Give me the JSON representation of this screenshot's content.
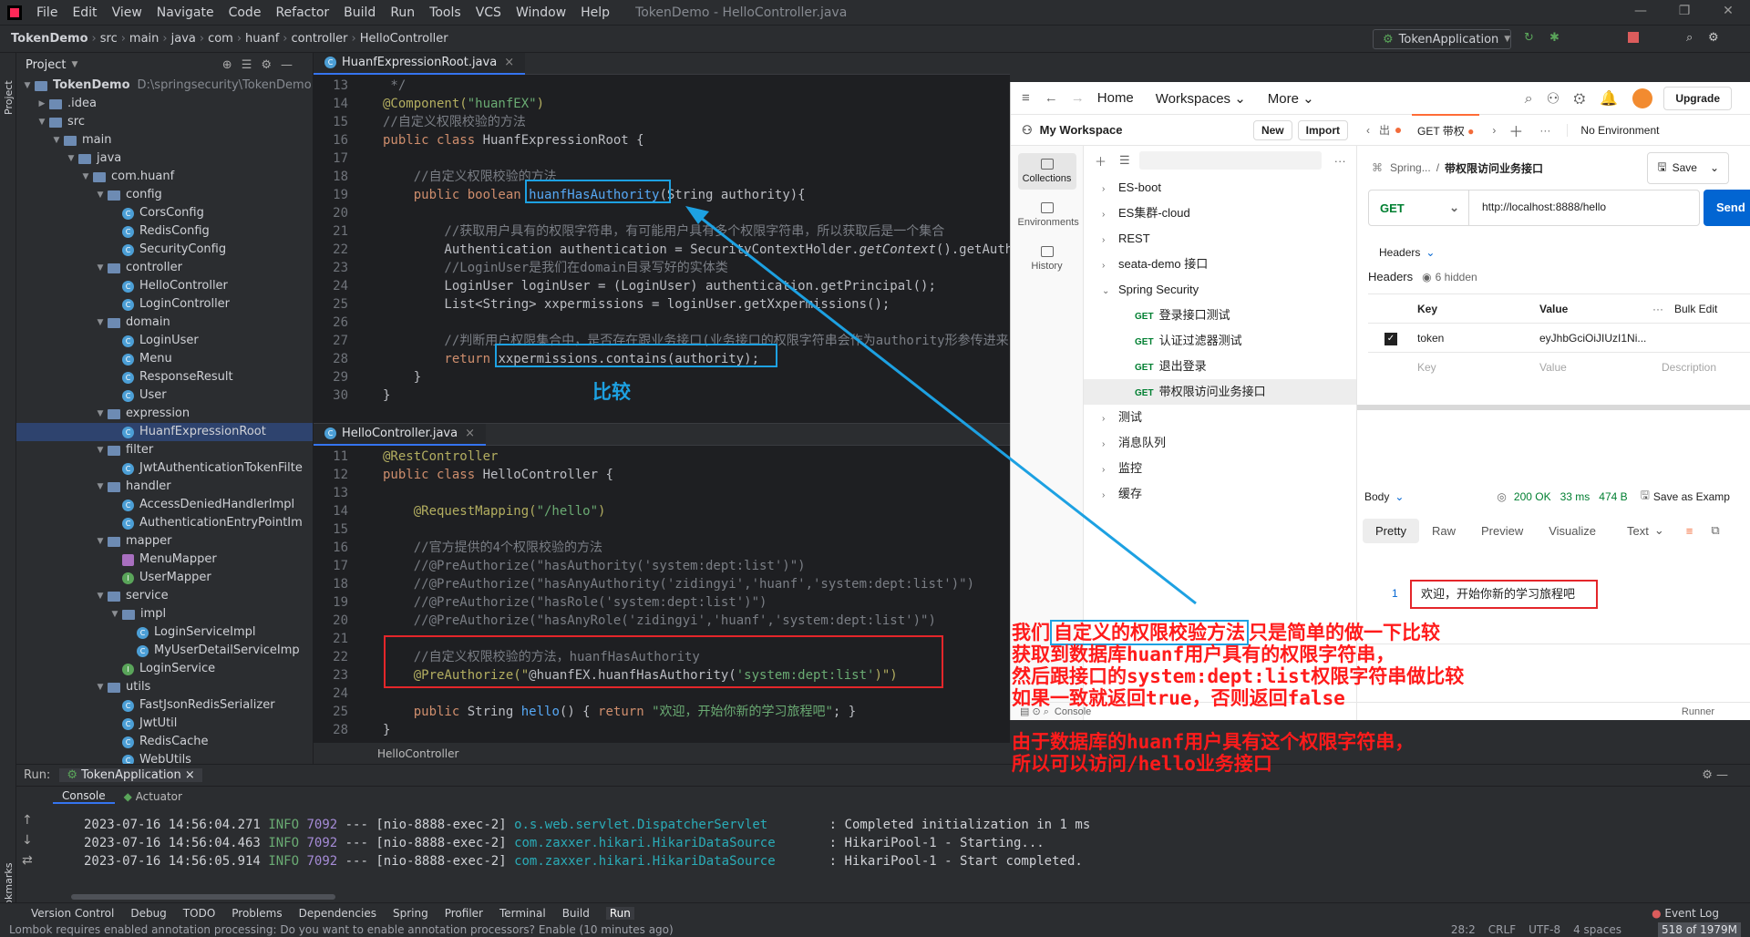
{
  "menubar": {
    "items": [
      "File",
      "Edit",
      "View",
      "Navigate",
      "Code",
      "Refactor",
      "Build",
      "Run",
      "Tools",
      "VCS",
      "Window",
      "Help"
    ],
    "window_title": "TokenDemo - HelloController.java"
  },
  "navbar": {
    "crumbs": [
      "TokenDemo",
      "src",
      "main",
      "java",
      "com",
      "huanf",
      "controller",
      "HelloController"
    ],
    "run_config": "TokenApplication"
  },
  "left_stripe": {
    "project": "Project",
    "bookmarks": "Bookmarks"
  },
  "project": {
    "header": "Project",
    "root_name": "TokenDemo",
    "root_path": "D:\\springsecurity\\TokenDemo",
    "items": [
      {
        "label": ".idea"
      },
      {
        "label": "src"
      },
      {
        "label": "main"
      },
      {
        "label": "java"
      },
      {
        "label": "com.huanf"
      },
      {
        "label": "config"
      },
      {
        "label": "CorsConfig"
      },
      {
        "label": "RedisConfig"
      },
      {
        "label": "SecurityConfig"
      },
      {
        "label": "controller"
      },
      {
        "label": "HelloController"
      },
      {
        "label": "LoginController"
      },
      {
        "label": "domain"
      },
      {
        "label": "LoginUser"
      },
      {
        "label": "Menu"
      },
      {
        "label": "ResponseResult"
      },
      {
        "label": "User"
      },
      {
        "label": "expression"
      },
      {
        "label": "HuanfExpressionRoot"
      },
      {
        "label": "filter"
      },
      {
        "label": "JwtAuthenticationTokenFilte"
      },
      {
        "label": "handler"
      },
      {
        "label": "AccessDeniedHandlerImpl"
      },
      {
        "label": "AuthenticationEntryPointIm"
      },
      {
        "label": "mapper"
      },
      {
        "label": "MenuMapper"
      },
      {
        "label": "UserMapper"
      },
      {
        "label": "service"
      },
      {
        "label": "impl"
      },
      {
        "label": "LoginServiceImpl"
      },
      {
        "label": "MyUserDetailServiceImp"
      },
      {
        "label": "LoginService"
      },
      {
        "label": "utils"
      },
      {
        "label": "FastJsonRedisSerializer"
      },
      {
        "label": "JwtUtil"
      },
      {
        "label": "RedisCache"
      },
      {
        "label": "WebUtils"
      }
    ]
  },
  "editor_top": {
    "tab": "HuanfExpressionRoot.java",
    "lines": [
      {
        "n": "13",
        "parts": [
          {
            "t": " */",
            "c": "cm"
          }
        ]
      },
      {
        "n": "14",
        "parts": [
          {
            "t": "@Component(",
            "c": "an"
          },
          {
            "t": "\"huanfEX\"",
            "c": "st"
          },
          {
            "t": ")",
            "c": "an"
          }
        ]
      },
      {
        "n": "15",
        "parts": [
          {
            "t": "//自定义权限校验的方法",
            "c": "cm"
          }
        ]
      },
      {
        "n": "16",
        "parts": [
          {
            "t": "public class ",
            "c": "kw"
          },
          {
            "t": "HuanfExpressionRoot {",
            "c": "df"
          }
        ]
      },
      {
        "n": "17",
        "parts": []
      },
      {
        "n": "18",
        "parts": [
          {
            "t": "    //自定义权限校验的方法",
            "c": "cm"
          }
        ]
      },
      {
        "n": "19",
        "parts": [
          {
            "t": "    public boolean ",
            "c": "kw"
          },
          {
            "t": "huanfHasAuthority",
            "c": "fn"
          },
          {
            "t": "(String authority){",
            "c": "df"
          }
        ]
      },
      {
        "n": "20",
        "parts": []
      },
      {
        "n": "21",
        "parts": [
          {
            "t": "        //获取用户具有的权限字符串，有可能用户具有多个权限字符串，所以获取后是一个集合",
            "c": "cm"
          }
        ]
      },
      {
        "n": "22",
        "parts": [
          {
            "t": "        Authentication authentication = SecurityContextHolder.",
            "c": "df"
          },
          {
            "t": "getContext",
            "c": "df it"
          },
          {
            "t": "().getAuthentication();",
            "c": "df"
          }
        ]
      },
      {
        "n": "23",
        "parts": [
          {
            "t": "        //LoginUser是我们在domain目录写好的实体类",
            "c": "cm"
          }
        ]
      },
      {
        "n": "24",
        "parts": [
          {
            "t": "        LoginUser loginUser = (LoginUser) authentication.getPrincipal();",
            "c": "df"
          }
        ]
      },
      {
        "n": "25",
        "parts": [
          {
            "t": "        List<String> xxpermissions = loginUser.getXxpermissions();",
            "c": "df"
          }
        ]
      },
      {
        "n": "26",
        "parts": []
      },
      {
        "n": "27",
        "parts": [
          {
            "t": "        //判断用户权限集合中，是否存在跟业务接口(业务接口的权限字符串会作为authority形参传进来)一样的权限",
            "c": "cm"
          }
        ]
      },
      {
        "n": "28",
        "parts": [
          {
            "t": "        return ",
            "c": "kw"
          },
          {
            "t": "xxpermissions.contains(authority);",
            "c": "df"
          }
        ]
      },
      {
        "n": "29",
        "parts": [
          {
            "t": "    }",
            "c": "df"
          }
        ]
      },
      {
        "n": "30",
        "parts": [
          {
            "t": "}",
            "c": "df"
          }
        ]
      }
    ]
  },
  "editor_bottom": {
    "tab": "HelloController.java",
    "footer": "HelloController",
    "lines": [
      {
        "n": "11",
        "parts": [
          {
            "t": "@RestController",
            "c": "an"
          }
        ]
      },
      {
        "n": "12",
        "parts": [
          {
            "t": "public class ",
            "c": "kw"
          },
          {
            "t": "HelloController {",
            "c": "df"
          }
        ]
      },
      {
        "n": "13",
        "parts": []
      },
      {
        "n": "14",
        "parts": [
          {
            "t": "    @RequestMapping(",
            "c": "an"
          },
          {
            "t": "\"/hello\"",
            "c": "st"
          },
          {
            "t": ")",
            "c": "an"
          }
        ]
      },
      {
        "n": "15",
        "parts": []
      },
      {
        "n": "16",
        "parts": [
          {
            "t": "    //官方提供的4个权限校验的方法",
            "c": "cm"
          }
        ]
      },
      {
        "n": "17",
        "parts": [
          {
            "t": "    //@PreAuthorize(\"hasAuthority('system:dept:list')\")",
            "c": "cm"
          }
        ]
      },
      {
        "n": "18",
        "parts": [
          {
            "t": "    //@PreAuthorize(\"hasAnyAuthority('zidingyi','huanf','system:dept:list')\")",
            "c": "cm"
          }
        ]
      },
      {
        "n": "19",
        "parts": [
          {
            "t": "    //@PreAuthorize(\"hasRole('system:dept:list')\")",
            "c": "cm"
          }
        ]
      },
      {
        "n": "20",
        "parts": [
          {
            "t": "    //@PreAuthorize(\"hasAnyRole('zidingyi','huanf','system:dept:list')\")",
            "c": "cm"
          }
        ]
      },
      {
        "n": "21",
        "parts": []
      },
      {
        "n": "22",
        "parts": [
          {
            "t": "    //自定义权限校验的方法，huanfHasAuthority",
            "c": "cm"
          }
        ]
      },
      {
        "n": "23",
        "parts": [
          {
            "t": "    @PreAuthorize(\"",
            "c": "an"
          },
          {
            "t": "@huanfEX.huanfHasAuthority(",
            "c": "df"
          },
          {
            "t": "'system:dept:list'",
            "c": "st"
          },
          {
            "t": ")\")",
            "c": "an"
          }
        ]
      },
      {
        "n": "24",
        "parts": []
      },
      {
        "n": "25",
        "parts": [
          {
            "t": "    public ",
            "c": "kw"
          },
          {
            "t": "String ",
            "c": "df"
          },
          {
            "t": "hello",
            "c": "fn"
          },
          {
            "t": "() { ",
            "c": "df"
          },
          {
            "t": "return ",
            "c": "kw"
          },
          {
            "t": "\"欢迎，开始你新的学习旅程吧\"",
            "c": "st"
          },
          {
            "t": "; }",
            "c": "df"
          }
        ]
      },
      {
        "n": "28",
        "parts": [
          {
            "t": "}",
            "c": "df"
          }
        ]
      }
    ]
  },
  "postman": {
    "nav": {
      "home": "Home",
      "workspaces": "Workspaces",
      "more": "More",
      "upgrade": "Upgrade"
    },
    "workspace": "My Workspace",
    "new_btn": "New",
    "import_btn": "Import",
    "sidebar": [
      "Collections",
      "Environments",
      "History"
    ],
    "collections": [
      {
        "label": "ES-boot",
        "open": false
      },
      {
        "label": "ES集群-cloud",
        "open": false
      },
      {
        "label": "REST",
        "open": false
      },
      {
        "label": "seata-demo 接口",
        "open": false
      },
      {
        "label": "Spring Security",
        "open": true
      },
      {
        "label": "测试",
        "open": false
      },
      {
        "label": "消息队列",
        "open": false
      },
      {
        "label": "监控",
        "open": false
      },
      {
        "label": "缓存",
        "open": false
      }
    ],
    "requests": [
      {
        "method": "GET",
        "label": "登录接口测试"
      },
      {
        "method": "GET",
        "label": "认证过滤器测试"
      },
      {
        "method": "GET",
        "label": "退出登录"
      },
      {
        "method": "GET",
        "label": "带权限访问业务接口"
      }
    ],
    "tabs": {
      "left": "出",
      "active": "GET 带权",
      "env": "No Environment"
    },
    "breadcrumb": {
      "parent": "Spring...",
      "sep": "/",
      "current": "带权限访问业务接口"
    },
    "save": "Save",
    "method": "GET",
    "url": "http://localhost:8888/hello",
    "send": "Send",
    "headers_tab": "Headers",
    "headers_title": "Headers",
    "hidden": "6 hidden",
    "cols": {
      "key": "Key",
      "value": "Value",
      "bulk": "Bulk Edit",
      "desc": "Description"
    },
    "header_row": {
      "key": "token",
      "value": "eyJhbGciOiJIUzI1Ni..."
    },
    "placeholder_row": {
      "key": "Key",
      "value": "Value",
      "desc": "Description"
    },
    "body_label": "Body",
    "status": "200 OK",
    "time": "33 ms",
    "size": "474 B",
    "save_as": "Save as Examp",
    "resp_tabs": [
      "Pretty",
      "Raw",
      "Preview",
      "Visualize"
    ],
    "resp_format": "Text",
    "resp_line_no": "1",
    "resp_text": "欢迎，开始你新的学习旅程吧",
    "console": "Console",
    "runner": "Runner"
  },
  "run_panel": {
    "title": "Run:",
    "config": "TokenApplication",
    "tabs": [
      "Console",
      "Actuator"
    ],
    "logs": [
      {
        "ts": "2023-07-16 14:56:04.271",
        "lvl": "INFO",
        "pid": "7092",
        "mid": "--- [nio-8888-exec-2]",
        "cls": "o.s.web.servlet.DispatcherServlet       ",
        "msg": ": Completed initialization in 1 ms"
      },
      {
        "ts": "2023-07-16 14:56:04.463",
        "lvl": "INFO",
        "pid": "7092",
        "mid": "--- [nio-8888-exec-2]",
        "cls": "com.zaxxer.hikari.HikariDataSource      ",
        "msg": ": HikariPool-1 - Starting..."
      },
      {
        "ts": "2023-07-16 14:56:05.914",
        "lvl": "INFO",
        "pid": "7092",
        "mid": "--- [nio-8888-exec-2]",
        "cls": "com.zaxxer.hikari.HikariDataSource      ",
        "msg": ": HikariPool-1 - Start completed."
      }
    ]
  },
  "bottom_tools": [
    "Version Control",
    "Debug",
    "TODO",
    "Problems",
    "Dependencies",
    "Spring",
    "Profiler",
    "Terminal",
    "Build",
    "Run"
  ],
  "event_log": "Event Log",
  "status": {
    "message": "Lombok requires enabled annotation processing: Do you want to enable annotation processors? Enable (10 minutes ago)",
    "pos": "28:2",
    "eol": "CRLF",
    "enc": "UTF-8",
    "indent": "4 spaces",
    "mem": "518 of 1979M"
  },
  "annotations": {
    "compare": "比较",
    "para1": [
      {
        "pre": "我们",
        "hl": "自定义的权限校验方法",
        "post": "只是简单的做一下比较"
      },
      {
        "pre": "获取到数据库huanf用户具有的权限字符串，",
        "hl": "",
        "post": ""
      },
      {
        "pre": "然后跟接口的system:dept:list权限字符串做比较",
        "hl": "",
        "post": ""
      },
      {
        "pre": "如果一致就返回true，否则返回false",
        "hl": "",
        "post": ""
      }
    ],
    "para2": [
      "由于数据库的huanf用户具有这个权限字符串，",
      "所以可以访问/hello业务接口"
    ]
  },
  "colors": {
    "accent": "#3574f0",
    "annot_red": "#ff1b1b",
    "annot_blue": "#1da1e2",
    "postman_send": "#0265d2",
    "get_green": "#007f31"
  }
}
